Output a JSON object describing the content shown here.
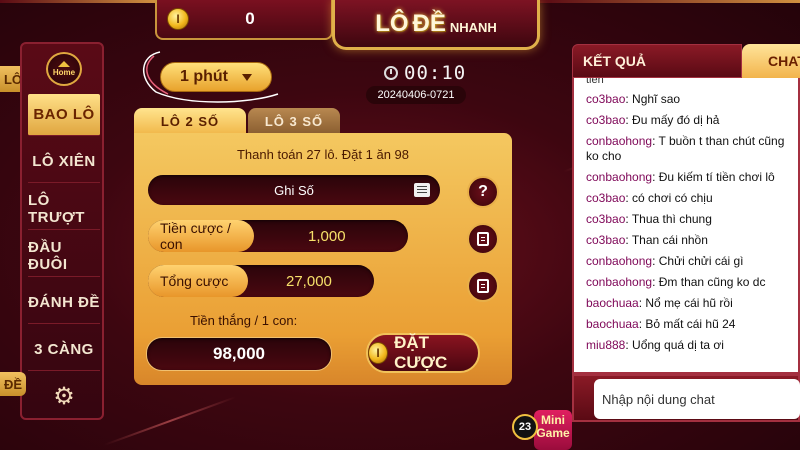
{
  "header": {
    "coin_symbol": "I",
    "coin_balance": "0",
    "logo_word_1": "LÔ",
    "logo_word_2": "ĐỀ",
    "logo_word_3": "NHANH"
  },
  "sidebar": {
    "home_label": "Home",
    "lo_tab": "LÔ",
    "de_tab": "ĐỀ",
    "items": [
      {
        "label": "BAO LÔ",
        "active": true
      },
      {
        "label": "LÔ XIÊN",
        "active": false
      },
      {
        "label": "LÔ TRƯỢT",
        "active": false
      },
      {
        "label": "ĐẦU ĐUÔI",
        "active": false
      },
      {
        "label": "ĐÁNH ĐỀ",
        "active": false
      },
      {
        "label": "3 CÀNG",
        "active": false
      }
    ],
    "settings_icon": "gear-icon"
  },
  "round": {
    "period_selected": "1 phút",
    "timer": "00:10",
    "session_id": "20240406-0721"
  },
  "tabs": {
    "lo2": "LÔ 2 SỐ",
    "lo3": "LÔ 3 SỐ"
  },
  "bet": {
    "payout_info": "Thanh toán 27 lô. Đặt 1 ăn 98",
    "ghi_so_label": "Ghi Số",
    "stake_label": "Tiền cược / con",
    "stake_value": "1,000",
    "total_label": "Tổng cược",
    "total_value": "27,000",
    "win_label": "Tiền thắng / 1 con:",
    "win_value": "98,000",
    "place_bet_label": "ĐẶT CƯỢC",
    "help_label": "?"
  },
  "results": {
    "title": "KẾT QUẢ",
    "chat_tab": "CHAT",
    "cut_off_line": "tiền",
    "messages": [
      {
        "user": "co3bao",
        "text": "Nghĩ sao"
      },
      {
        "user": "co3bao",
        "text": "Đu mấy đó dị hả"
      },
      {
        "user": "conbaohong",
        "text": "T buồn t than chút cũng ko cho"
      },
      {
        "user": "conbaohong",
        "text": "Đu kiếm tí tiền chơi lô"
      },
      {
        "user": "co3bao",
        "text": "có chơi có chịu"
      },
      {
        "user": "co3bao",
        "text": "Thua thì chung"
      },
      {
        "user": "co3bao",
        "text": "Than cái nhồn"
      },
      {
        "user": "conbaohong",
        "text": "Chửi chửi cái gì"
      },
      {
        "user": "conbaohong",
        "text": "Đm than cũng ko dc"
      },
      {
        "user": "baochuaa",
        "text": "Nổ mẹ cái hũ rồi"
      },
      {
        "user": "baochuaa",
        "text": "Bỏ  mất cái hũ 24"
      },
      {
        "user": "miu888",
        "text": "Uổng quá dị ta ơi"
      }
    ],
    "chat_placeholder": "Nhập nội dung chat"
  },
  "mini_game": {
    "badge": "23",
    "label": "Mini Game"
  }
}
